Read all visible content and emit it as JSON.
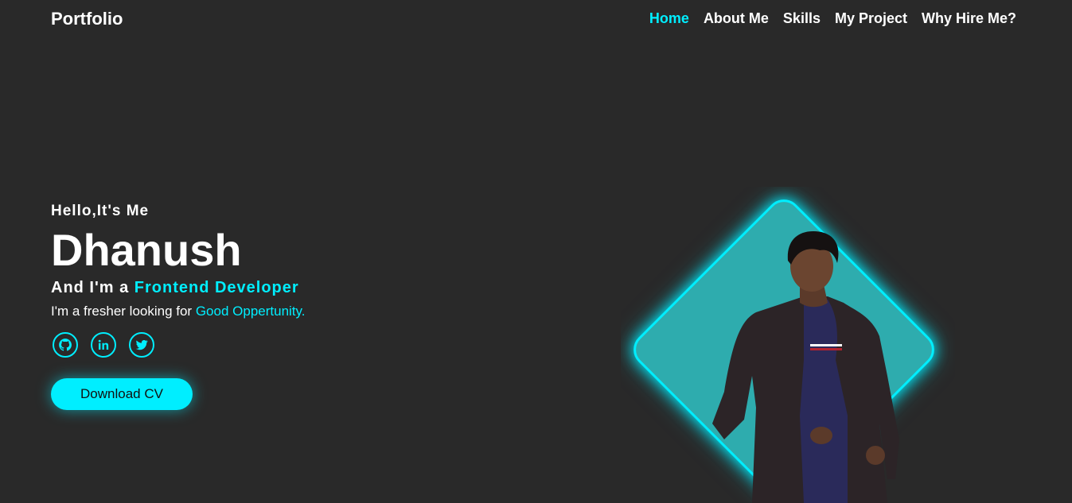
{
  "header": {
    "logo": "Portfolio",
    "nav": [
      {
        "label": "Home",
        "active": true
      },
      {
        "label": "About Me",
        "active": false
      },
      {
        "label": "Skills",
        "active": false
      },
      {
        "label": "My Project",
        "active": false
      },
      {
        "label": "Why Hire Me?",
        "active": false
      }
    ]
  },
  "hero": {
    "greeting": "Hello,It's Me",
    "name": "Dhanush",
    "role_prefix": "And I'm a ",
    "role_highlight": "Frontend Developer",
    "tagline_prefix": "I'm a fresher looking for ",
    "tagline_highlight": "Good Oppertunity.",
    "socials": [
      "github-icon",
      "linkedin-icon",
      "twitter-icon"
    ],
    "cta_label": "Download CV"
  },
  "colors": {
    "background": "#292929",
    "accent": "#00eeff",
    "diamond_fill": "#2eacae",
    "text": "#ffffff"
  }
}
